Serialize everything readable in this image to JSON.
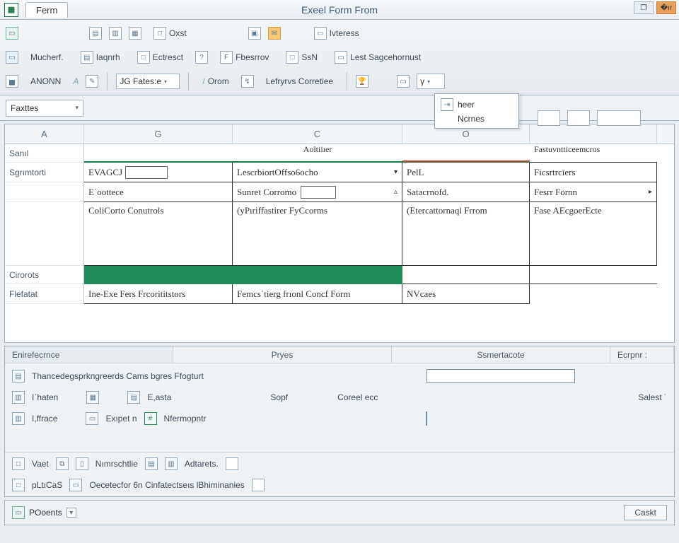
{
  "titlebar": {
    "tab": "Ferm",
    "title": "Exeel Form From",
    "win_mid": "❐",
    "win_right": "�ır"
  },
  "ribbon": {
    "row1": {
      "b1": "Oxst",
      "b2": "Ivteress"
    },
    "row2": {
      "b1": "Mucherf.",
      "b2": "Iaqnrh",
      "b3": "Ectresct",
      "b4": "Fbesrrov",
      "b5": "SsN",
      "b6": "Lest Sagcehornust"
    },
    "row3": {
      "b1": "ANONN",
      "combo1": "JG Fates:e",
      "b2": "Orom",
      "b3": "Lefryrvs Corretiee"
    }
  },
  "popup": {
    "l1": "heer",
    "l2": "Ncrnes"
  },
  "namebox": "Faxttes",
  "grid": {
    "cols": {
      "a": "A",
      "g": "G",
      "c": "C",
      "o": "O",
      "e": ""
    },
    "rowlabels": [
      "Sanıl",
      "Sgrımtorti",
      "",
      "",
      "Cirorots",
      "Flefatat"
    ],
    "top_header": {
      "g": "",
      "c": "Aoltiiıer",
      "o": "",
      "e": "Fastuvntticeemcros"
    },
    "r1": {
      "g": "EVAGCJ",
      "c": "LescrbiortOffso6ocho",
      "o": "PelL",
      "e": "Ficsrtrcīers"
    },
    "r2": {
      "g": "Eˈoottece",
      "c": "Sunret Corromo",
      "o": "Satacrnofd.",
      "e": "Fesrr Fornn"
    },
    "r3": {
      "g": "ColiCorto Conutrols",
      "c": "(yPıriffastirer FyCcorms",
      "o": "(Etercattornaql Frrom",
      "e": "Fase AEcgoerEcte"
    },
    "r5": {
      "g": "Ine-Exe Fers Frcorititstors",
      "c": "Femcsˈtierg frıonl Concf Form",
      "o": "NVcaes",
      "e": ""
    }
  },
  "panel": {
    "tabs": [
      "Enirefecrnce",
      "Pryes",
      "Ssmertacote",
      "Ecrpnr :"
    ],
    "line1": "Thancedegsprkngreerds Cams bgres Ffogturt",
    "line2": {
      "a": "Iˈhaten",
      "b": "E,asta",
      "c": "Sopf",
      "d": "Coreel ecc",
      "e": "Salest ˙"
    },
    "line3": {
      "a": "I,ffrace",
      "b": "Exıpet n",
      "c": "Nfermopntr"
    },
    "strip1": {
      "a": "Vaet",
      "b": "Nımrschtlie",
      "c": "Adtarets."
    },
    "strip2": {
      "a": "pLtıCaS",
      "b": "Oecetecfor 6n Cinfatectseıs lBhiminanies"
    }
  },
  "status": {
    "left": "POoents",
    "btn": "Caskt"
  }
}
